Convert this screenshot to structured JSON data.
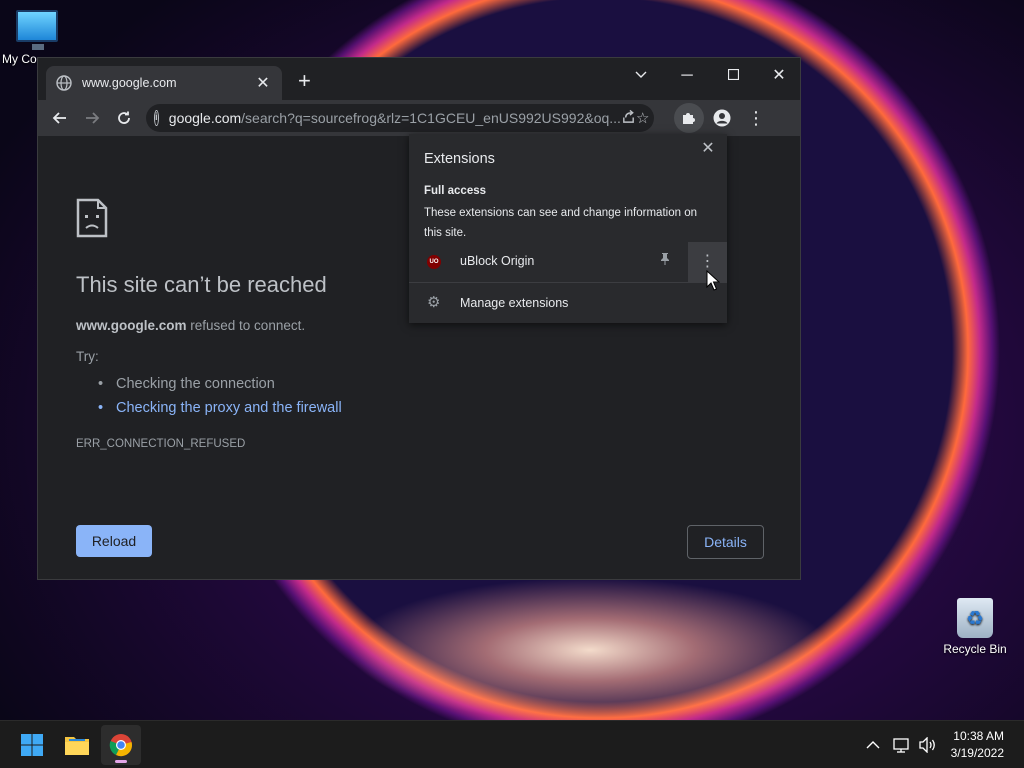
{
  "desktop": {
    "icons": [
      {
        "label": "My Co"
      },
      {
        "label": "Recycle Bin"
      }
    ]
  },
  "browser": {
    "tab": {
      "title": "www.google.com"
    },
    "omnibox": {
      "host": "google.com",
      "path": "/search?q=sourcefrog&rlz=1C1GCEU_enUS992US992&oq..."
    }
  },
  "error_page": {
    "title": "This site can’t be reached",
    "host": "www.google.com",
    "host_suffix": " refused to connect.",
    "try_label": "Try:",
    "suggestions": [
      "Checking the connection",
      "Checking the proxy and the firewall"
    ],
    "code": "ERR_CONNECTION_REFUSED",
    "reload_label": "Reload",
    "details_label": "Details"
  },
  "extensions_popup": {
    "title": "Extensions",
    "section": "Full access",
    "description": "These extensions can see and change information on this site.",
    "items": [
      {
        "name": "uBlock Origin",
        "icon_text": "UO"
      }
    ],
    "manage_label": "Manage extensions"
  },
  "taskbar": {
    "time": "10:38 AM",
    "date": "3/19/2022"
  },
  "colors": {
    "accent_link": "#8ab4f8",
    "chrome_dark": "#202124",
    "toolbar": "#35363a",
    "taskbar": "#1c1c1c"
  }
}
